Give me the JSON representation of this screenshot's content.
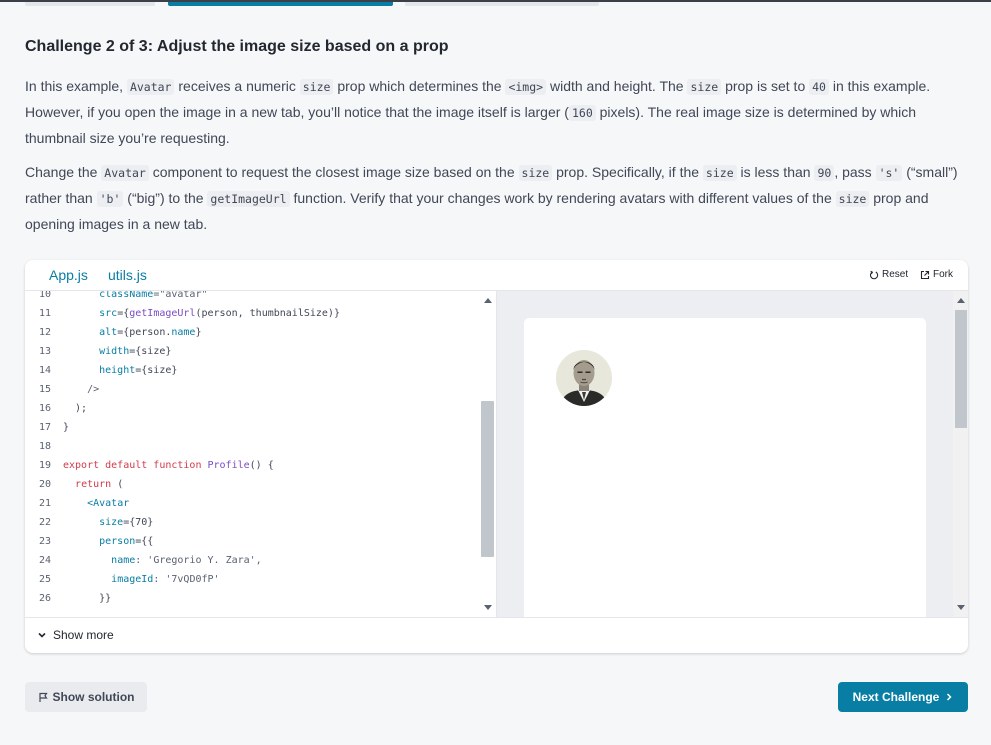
{
  "challenge": {
    "number_label": "Challenge 2 of 3:",
    "title": "Adjust the image size based on a prop"
  },
  "paragraph1": {
    "t1": "In this example, ",
    "c1": "Avatar",
    "t2": " receives a numeric ",
    "c2": "size",
    "t3": " prop which determines the ",
    "c3": "<img>",
    "t4": " width and height. The ",
    "c4": "size",
    "t5": " prop is set to ",
    "c5": "40",
    "t6": " in this example. However, if you open the image in a new tab, you’ll notice that the image itself is larger (",
    "c6": "160",
    "t7": " pixels). The real image size is determined by which thumbnail size you’re requesting."
  },
  "paragraph2": {
    "t1": "Change the ",
    "c1": "Avatar",
    "t2": " component to request the closest image size based on the ",
    "c2": "size",
    "t3": " prop. Specifically, if the ",
    "c3": "size",
    "t4": " is less than ",
    "c4": "90",
    "t5": ", pass ",
    "c5": "'s'",
    "t6": " (“small”) rather than ",
    "c6": "'b'",
    "t7": " (“big”) to the ",
    "c7": "getImageUrl",
    "t8": " function. Verify that your changes work by rendering avatars with different values of the ",
    "c8": "size",
    "t9": " prop and opening images in a new tab."
  },
  "sandbox": {
    "tabs": [
      "App.js",
      "utils.js"
    ],
    "reset_label": "Reset",
    "fork_label": "Fork",
    "show_more_label": "Show more",
    "preview_alt": "Gregorio Y. Zara"
  },
  "code_lines": [
    {
      "n": "10",
      "parts": [
        {
          "t": "      ",
          "c": ""
        },
        {
          "t": "className",
          "c": "at"
        },
        {
          "t": "=\"avatar\"",
          "c": "st"
        }
      ]
    },
    {
      "n": "11",
      "parts": [
        {
          "t": "      ",
          "c": ""
        },
        {
          "t": "src",
          "c": "at"
        },
        {
          "t": "={",
          "c": ""
        },
        {
          "t": "getImageUrl",
          "c": "fn"
        },
        {
          "t": "(person, thumbnailSize)}",
          "c": ""
        }
      ]
    },
    {
      "n": "12",
      "parts": [
        {
          "t": "      ",
          "c": ""
        },
        {
          "t": "alt",
          "c": "at"
        },
        {
          "t": "={person.",
          "c": ""
        },
        {
          "t": "name",
          "c": "at"
        },
        {
          "t": "}",
          "c": ""
        }
      ]
    },
    {
      "n": "13",
      "parts": [
        {
          "t": "      ",
          "c": ""
        },
        {
          "t": "width",
          "c": "at"
        },
        {
          "t": "={size}",
          "c": ""
        }
      ]
    },
    {
      "n": "14",
      "parts": [
        {
          "t": "      ",
          "c": ""
        },
        {
          "t": "height",
          "c": "at"
        },
        {
          "t": "={size}",
          "c": ""
        }
      ]
    },
    {
      "n": "15",
      "parts": [
        {
          "t": "    />",
          "c": "st"
        }
      ]
    },
    {
      "n": "16",
      "parts": [
        {
          "t": "  );",
          "c": ""
        }
      ]
    },
    {
      "n": "17",
      "parts": [
        {
          "t": "}",
          "c": ""
        }
      ]
    },
    {
      "n": "18",
      "parts": []
    },
    {
      "n": "19",
      "parts": [
        {
          "t": "export default function ",
          "c": "kw"
        },
        {
          "t": "Profile",
          "c": "fn"
        },
        {
          "t": "() {",
          "c": ""
        }
      ]
    },
    {
      "n": "20",
      "parts": [
        {
          "t": "  ",
          "c": ""
        },
        {
          "t": "return",
          "c": "kw"
        },
        {
          "t": " (",
          "c": ""
        }
      ]
    },
    {
      "n": "21",
      "parts": [
        {
          "t": "    ",
          "c": ""
        },
        {
          "t": "<Avatar",
          "c": "at"
        }
      ]
    },
    {
      "n": "22",
      "parts": [
        {
          "t": "      ",
          "c": ""
        },
        {
          "t": "size",
          "c": "at"
        },
        {
          "t": "={70}",
          "c": ""
        }
      ]
    },
    {
      "n": "23",
      "parts": [
        {
          "t": "      ",
          "c": ""
        },
        {
          "t": "person",
          "c": "at"
        },
        {
          "t": "={{",
          "c": ""
        }
      ]
    },
    {
      "n": "24",
      "parts": [
        {
          "t": "        ",
          "c": ""
        },
        {
          "t": "name",
          "c": "at"
        },
        {
          "t": ": 'Gregorio Y. Zara',",
          "c": "st"
        }
      ]
    },
    {
      "n": "25",
      "parts": [
        {
          "t": "        ",
          "c": ""
        },
        {
          "t": "imageId",
          "c": "at"
        },
        {
          "t": ": '7vQD0fP'",
          "c": "st"
        }
      ]
    },
    {
      "n": "26",
      "parts": [
        {
          "t": "      }}",
          "c": ""
        }
      ]
    }
  ],
  "actions": {
    "show_solution": "Show solution",
    "next_challenge": "Next Challenge"
  },
  "colors": {
    "accent": "#087ea4",
    "page_bg": "#f6f7f9"
  }
}
